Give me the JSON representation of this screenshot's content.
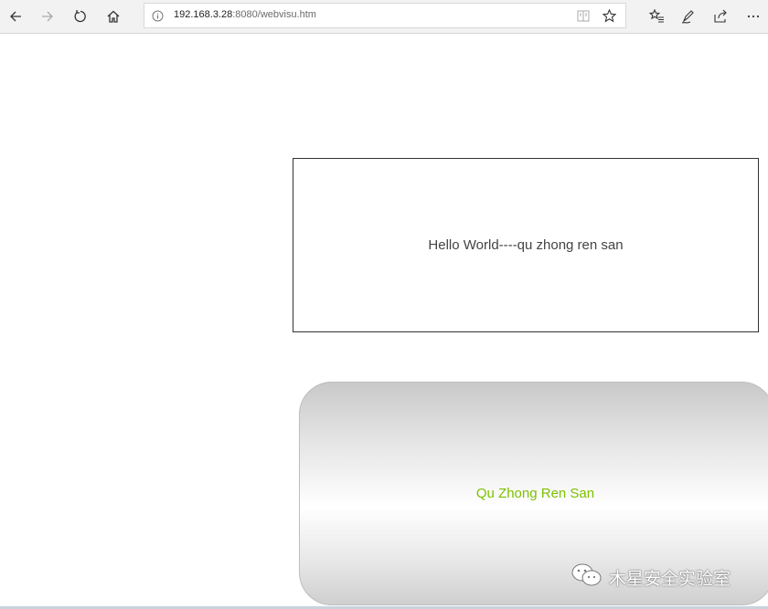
{
  "browser": {
    "url_host": "192.168.3.28",
    "url_rest": ":8080/webvisu.htm",
    "icons": {
      "back": "back-arrow-icon",
      "forward": "forward-arrow-icon",
      "refresh": "refresh-icon",
      "home": "home-icon",
      "info": "info-icon",
      "reading_view": "reading-view-icon",
      "favorite": "star-icon",
      "favorites_hub": "favorites-list-icon",
      "notes": "pen-notes-icon",
      "share": "share-icon",
      "more": "more-ellipsis-icon"
    }
  },
  "content": {
    "hello_text": "Hello World----qu zhong ren san",
    "gradient_text": "Qu Zhong Ren San",
    "gradient_text_color": "#7ec000"
  },
  "watermark": {
    "text": "木星安全实验室",
    "icon": "wechat-icon"
  }
}
